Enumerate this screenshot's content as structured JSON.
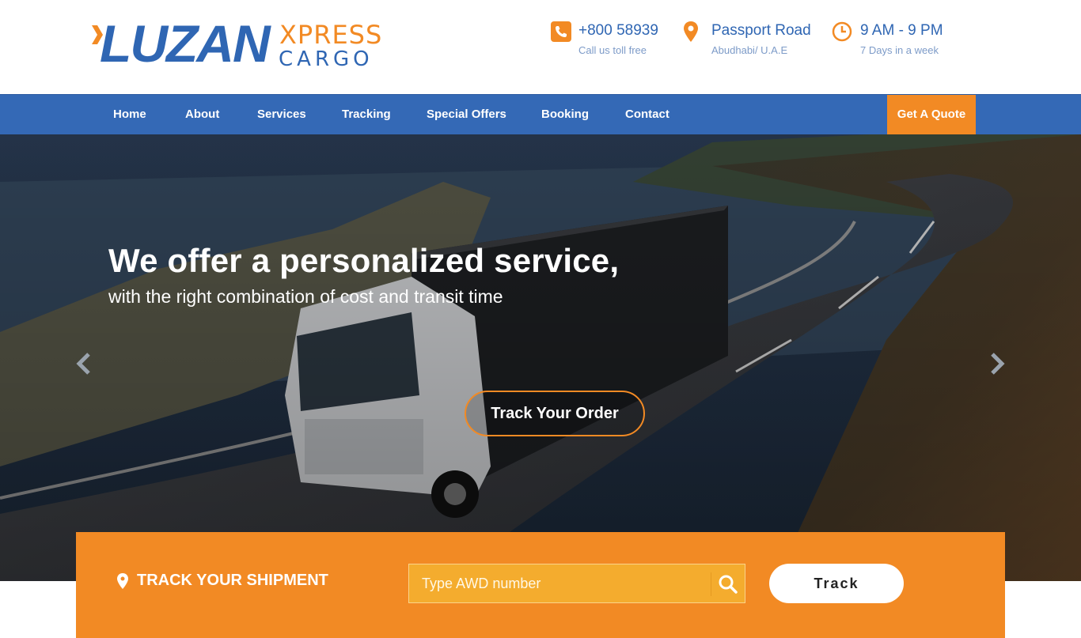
{
  "logo": {
    "main": "LUZAN",
    "line1": "XPRESS",
    "line2": "CARGO"
  },
  "header_info": [
    {
      "icon": "phone-icon",
      "title": "+800 58939",
      "subtitle": "Call us toll free"
    },
    {
      "icon": "map-pin-icon",
      "title": "Passport Road",
      "subtitle": "Abudhabi/ U.A.E"
    },
    {
      "icon": "clock-icon",
      "title": "9 AM - 9 PM",
      "subtitle": "7 Days in a week"
    }
  ],
  "nav": {
    "items": [
      "Home",
      "About",
      "Services",
      "Tracking",
      "Special Offers",
      "Booking",
      "Contact"
    ],
    "cta": "Get A Quote"
  },
  "hero": {
    "title": "We offer a personalized service,",
    "subtitle": "with the right combination of cost and transit time",
    "button": "Track Your Order"
  },
  "tracker": {
    "label": "TRACK YOUR SHIPMENT",
    "placeholder": "Type AWD number",
    "button": "Track"
  },
  "colors": {
    "brand_blue": "#3469b6",
    "brand_orange": "#f28a24"
  }
}
